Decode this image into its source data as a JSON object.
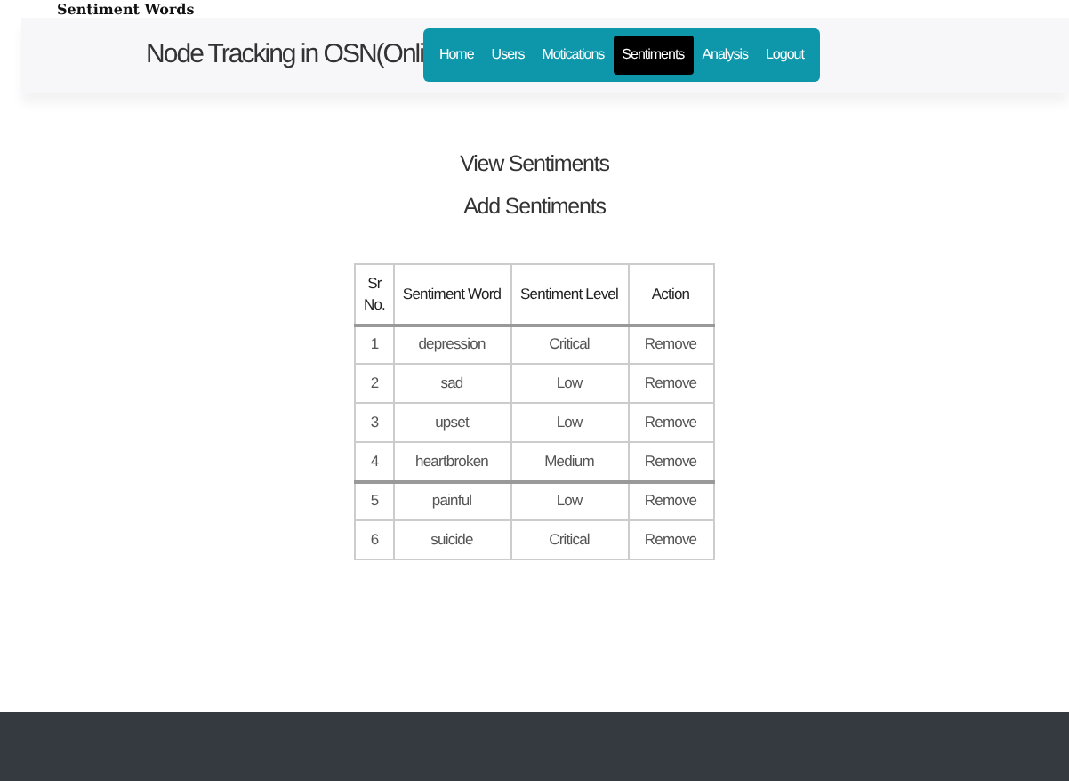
{
  "page_heading": "Sentiment Words",
  "header": {
    "title": "Node Tracking in OSN(Onli",
    "nav": [
      {
        "label": "Home",
        "selected": false
      },
      {
        "label": "Users",
        "selected": false
      },
      {
        "label": "Motications",
        "selected": false
      },
      {
        "label": "Sentiments",
        "selected": true
      },
      {
        "label": "Analysis",
        "selected": false
      },
      {
        "label": "Logout",
        "selected": false
      }
    ]
  },
  "links": [
    "View Sentiments",
    "Add Sentiments"
  ],
  "table": {
    "columns": [
      "Sr No.",
      "Sentiment Word",
      "Sentiment Level",
      "Action"
    ],
    "rows": [
      [
        "1",
        "depression",
        "Critical",
        "Remove"
      ],
      [
        "2",
        "sad",
        "Low",
        "Remove"
      ],
      [
        "3",
        "upset",
        "Low",
        "Remove"
      ],
      [
        "4",
        "heartbroken",
        "Medium",
        "Remove"
      ],
      [
        "5",
        "painful",
        "Low",
        "Remove"
      ],
      [
        "6",
        "suicide",
        "Critical",
        "Remove"
      ]
    ]
  }
}
